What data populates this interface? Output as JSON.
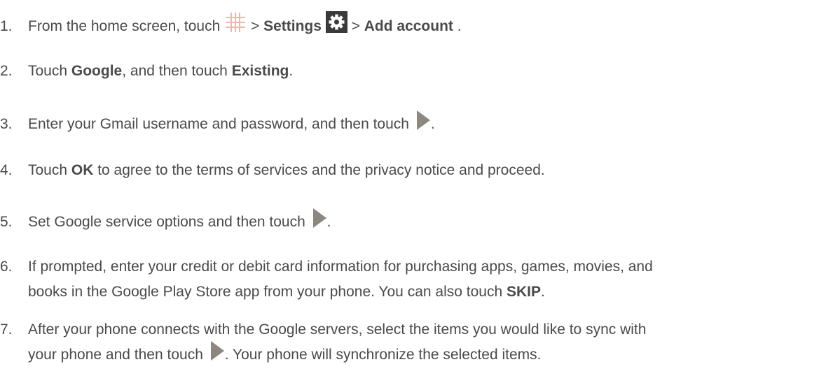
{
  "steps": [
    {
      "num": "1.",
      "parts": {
        "a": "From the home screen, touch",
        "b": " > ",
        "c": "Settings",
        "d": " > ",
        "e": "Add account",
        "f": "."
      }
    },
    {
      "num": "2.",
      "parts": {
        "a": "Touch ",
        "b": "Google",
        "c": ", and then touch ",
        "d": "Existing",
        "e": "."
      }
    },
    {
      "num": "3.",
      "parts": {
        "a": "Enter your Gmail username and password, and then touch",
        "b": "."
      }
    },
    {
      "num": "4.",
      "parts": {
        "a": "Touch ",
        "b": "OK",
        "c": " to agree to the terms of services and the privacy notice and proceed."
      }
    },
    {
      "num": "5.",
      "parts": {
        "a": "Set Google service options and then touch",
        "b": "."
      }
    },
    {
      "num": "6.",
      "parts": {
        "a": "If prompted, enter your credit or debit card information for purchasing apps, games, movies, and",
        "b": "books in the Google Play Store app from your phone. You can also touch ",
        "c": "SKIP",
        "d": "."
      }
    },
    {
      "num": "7.",
      "parts": {
        "a": "After your phone connects with the Google servers, select the items you would like to sync with",
        "b": "your phone and then touch",
        "c": ". Your phone will synchronize the selected items."
      }
    }
  ],
  "icons": {
    "apps": "apps-grid-icon",
    "settings": "settings-gear-icon",
    "next": "next-arrow-icon"
  },
  "colors": {
    "text": "#4a4a4a",
    "apps_icon": "#e8b9ad",
    "settings_icon_bg": "#3a3a3a",
    "next_icon": "#8c8880"
  }
}
